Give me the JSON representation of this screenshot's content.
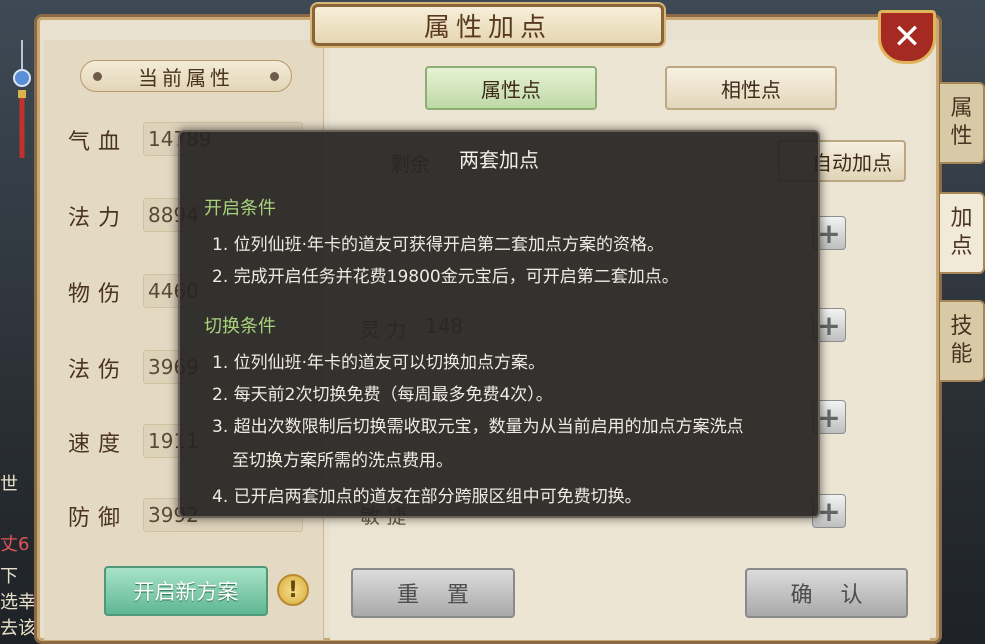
{
  "window": {
    "title": "属性加点",
    "close_label": "✕"
  },
  "left_panel": {
    "section_title": "当前属性",
    "stats": [
      {
        "label": "气血",
        "value": "14789"
      },
      {
        "label": "法力",
        "value": "8894"
      },
      {
        "label": "物伤",
        "value": "4460"
      },
      {
        "label": "法伤",
        "value": "3969"
      },
      {
        "label": "速度",
        "value": "1911"
      },
      {
        "label": "防御",
        "value": "3992"
      }
    ],
    "new_plan_label": "开启新方案",
    "warn_symbol": "!"
  },
  "right_panel": {
    "tabs": [
      {
        "label": "属性点",
        "active": true
      },
      {
        "label": "相性点",
        "active": false
      }
    ],
    "auto_assign_label": "自动加点",
    "partial_remaining_label": "剩余",
    "partial_stat_label": "灵 力",
    "partial_stat_value": "148",
    "partial_bottom_label": "敏 捷",
    "reset_label": "重置",
    "confirm_label": "确认"
  },
  "side_tabs": [
    {
      "label": "属性",
      "active": false
    },
    {
      "label": "加点",
      "active": true
    },
    {
      "label": "技能",
      "active": false
    }
  ],
  "left_strip": {
    "lines": [
      "世",
      "丈6",
      "下",
      "选幸",
      "去该"
    ]
  },
  "dialog": {
    "title": "两套加点",
    "sections": [
      {
        "heading": "开启条件",
        "items": [
          "1. 位列仙班·年卡的道友可获得开启第二套加点方案的资格。",
          "2. 完成开启任务并花费19800金元宝后，可开启第二套加点。"
        ]
      },
      {
        "heading": "切换条件",
        "items": [
          "1. 位列仙班·年卡的道友可以切换加点方案。",
          "2. 每天前2次切换免费（每周最多免费4次）。",
          "3. 超出次数限制后切换需收取元宝，数量为从当前启用的加点方案洗点",
          "至切换方案所需的洗点费用。",
          "4. 已开启两套加点的道友在部分跨服区组中可免费切换。"
        ]
      }
    ]
  },
  "colors": {
    "panel_bg": "#e9e1cf",
    "dialog_bg": "#262422",
    "section_heading": "#a7d27c",
    "active_tab": "#bfd9a6",
    "close_red": "#a52a22"
  }
}
